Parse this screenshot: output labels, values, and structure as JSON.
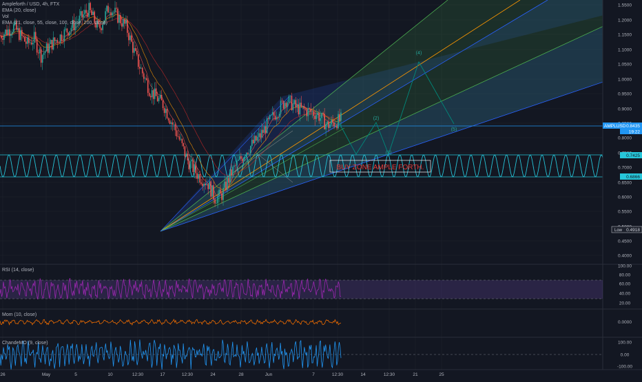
{
  "header": {
    "symbol": "Ampleforth / USD, 4h, FTX",
    "indicators": [
      "EMA (20, close)",
      "Vol",
      "EMA (21, close, 55, close, 100, close, 200, close)"
    ]
  },
  "annotation": {
    "buy_zone": "BUY ZONE AMPLE FORTH."
  },
  "waves": [
    {
      "label": "(2)",
      "x": 546,
      "y": 174
    },
    {
      "label": "(3)",
      "x": 564,
      "y": 224
    },
    {
      "label": "(4)",
      "x": 608,
      "y": 79
    },
    {
      "label": "(5)",
      "x": 659,
      "y": 190
    }
  ],
  "markers": {
    "price_label": "AMPLUSD",
    "price_value": "0.8435",
    "price_time": "19:22",
    "level_upper": "0.7425",
    "level_lower": "0.6866",
    "low_label": "Low",
    "low_value": "0.4918"
  },
  "panels": {
    "rsi": {
      "title": "RSI (14, close)",
      "ticks": [
        "100.00",
        "80.00",
        "60.00",
        "40.00",
        "20.00"
      ]
    },
    "mom": {
      "title": "Mom (10, close)",
      "ticks": [
        "0.0000"
      ]
    },
    "cmo": {
      "title": "ChandeMO (9, close)",
      "ticks": [
        "100.00",
        "0.00",
        "-100.00"
      ]
    }
  },
  "colors": {
    "background": "#131722",
    "up": "#26a69a",
    "down": "#ef5350",
    "rsi": "#9c27b0",
    "mom": "#ef6c00",
    "cmo": "#2196f3",
    "cycle": "#26c6da",
    "fan_blue": "#2962ff",
    "fan_green": "#4caf50"
  },
  "chart_data": {
    "type": "candlestick",
    "y_ticks": [
      "1.5500",
      "1.2000",
      "1.1500",
      "1.1000",
      "1.0500",
      "1.0000",
      "0.9500",
      "0.9000",
      "0.8500",
      "0.8000",
      "0.7500",
      "0.7000",
      "0.6500",
      "0.6000",
      "0.5500",
      "0.5000",
      "0.4500",
      "0.4000"
    ],
    "x_ticks": [
      "26",
      "May",
      "5",
      "10",
      "12:30",
      "17",
      "12:30",
      "24",
      "28",
      "Jun",
      "7",
      "12:30",
      "14",
      "12:30",
      "21",
      "25"
    ],
    "ylim": [
      0.37,
      1.2
    ],
    "price_path": [
      [
        0,
        1.13
      ],
      [
        0.04,
        1.16
      ],
      [
        0.08,
        1.1
      ],
      [
        0.1,
        1.12
      ],
      [
        0.12,
        1.06
      ],
      [
        0.15,
        1.1
      ],
      [
        0.2,
        1.15
      ],
      [
        0.23,
        1.18
      ],
      [
        0.26,
        1.22
      ],
      [
        0.29,
        1.15
      ],
      [
        0.32,
        1.23
      ],
      [
        0.37,
        1.16
      ],
      [
        0.4,
        1.05
      ],
      [
        0.44,
        0.94
      ],
      [
        0.48,
        0.89
      ],
      [
        0.52,
        0.79
      ],
      [
        0.55,
        0.7
      ],
      [
        0.58,
        0.65
      ],
      [
        0.61,
        0.62
      ],
      [
        0.63,
        0.57
      ],
      [
        0.65,
        0.58
      ],
      [
        0.68,
        0.66
      ],
      [
        0.72,
        0.73
      ],
      [
        0.76,
        0.78
      ],
      [
        0.8,
        0.85
      ],
      [
        0.84,
        0.91
      ],
      [
        0.87,
        0.88
      ],
      [
        0.9,
        0.87
      ],
      [
        0.93,
        0.86
      ],
      [
        0.96,
        0.82
      ],
      [
        1.0,
        0.84
      ]
    ]
  }
}
